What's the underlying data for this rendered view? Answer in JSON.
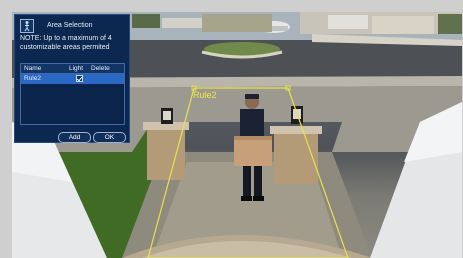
{
  "dialog": {
    "title": "Area Selection",
    "note": "NOTE: Up to a maximum of 4 customizable areas permited",
    "columns": {
      "name": "Name",
      "light": "Light",
      "delete": "Delete"
    },
    "rows": [
      {
        "name": "Rule2",
        "light_checked": true
      }
    ],
    "add_label": "Add",
    "ok_label": "OK",
    "icon": "area-selection-icon"
  },
  "overlay": {
    "rule_label": "Rule2",
    "rule_color": "#f0e84a"
  }
}
